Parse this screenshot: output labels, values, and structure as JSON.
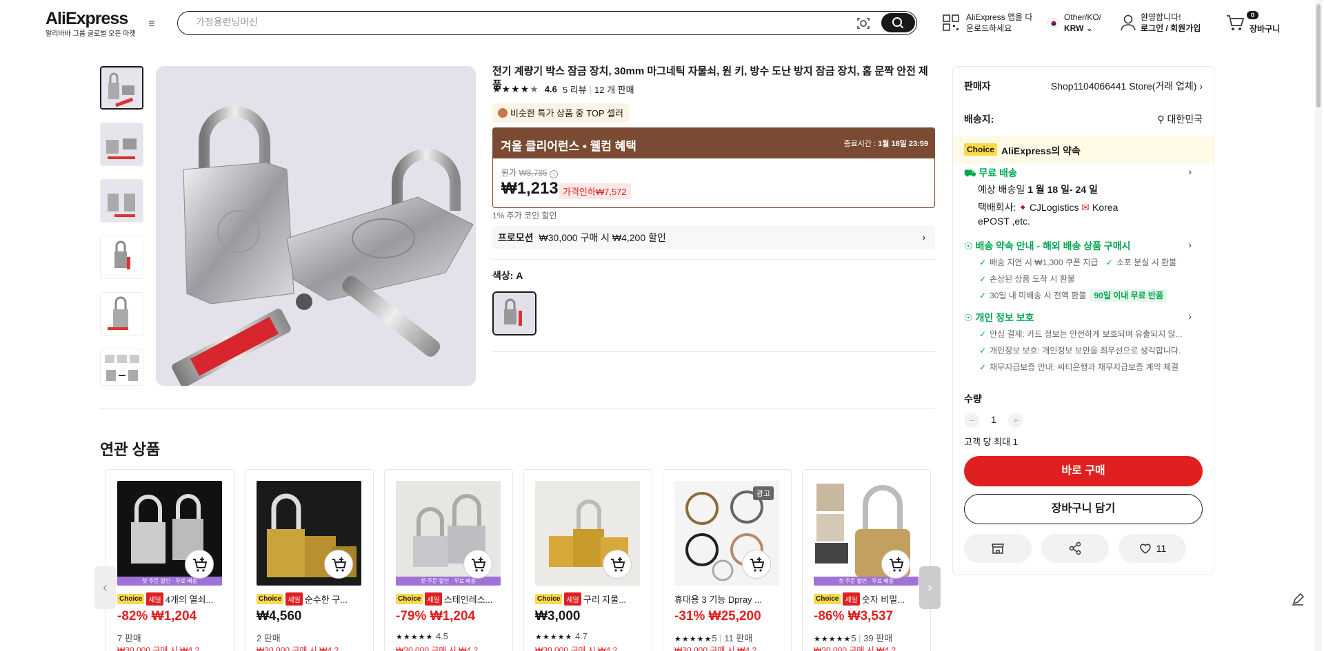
{
  "header": {
    "logo": "AliExpress",
    "logo_sub": "알리바바 그룹 글로벌 오픈 마켓",
    "search_placeholder": "가정용런닝머신",
    "app_line1": "AliExpress 앱을 다",
    "app_line2": "운로드하세요",
    "lang_line1": "Other/KO/",
    "lang_line2": "KRW",
    "welcome_line1": "환영합니다!",
    "welcome_line2": "로그인 / 회원가입",
    "cart_count": "0",
    "cart_label": "장바구니"
  },
  "product": {
    "title": "전기 계량기 박스 잠금 장치, 30mm 마그네틱 자물쇠, 원 키, 방수 도난 방지 잠금 장치, 홈 문짝 안전 제품",
    "rating": "4.6",
    "reviews": "5 리뷰",
    "sold": "12 개 판매",
    "top_badge": "비슷한 특가 상품 중 TOP 셀러",
    "promo_title": "겨울 클리어런스 • 웰컴 혜택",
    "promo_end_label": "종료시간 :",
    "promo_end_date": "1월 18일 23:59",
    "orig_label": "원가",
    "orig_price": "₩8,785",
    "price": "₩1,213",
    "discount": "가격인하₩7,572",
    "coin_note": "1% 추가 코인 할인",
    "promotion_label": "프로모션",
    "promotion_text": "₩30,000 구매 시 ₩4,200 할인",
    "color_label": "색상: A"
  },
  "related": {
    "title": "연관 상품",
    "strip_text": "첫 주문 할인 · 무료 배송",
    "ad_label": "광고",
    "items": [
      {
        "choice": "Choice",
        "sale": "세일",
        "name": "4개의 열쇠...",
        "discount": "-82%",
        "price": "₩1,204",
        "sold": "7 판매",
        "rating": "",
        "promo": "₩30,000 구매 시 ₩4,2"
      },
      {
        "choice": "Choice",
        "sale": "세일",
        "name": "순수한 구...",
        "discount": "",
        "price": "₩4,560",
        "sold": "2 판매",
        "rating": "",
        "promo": "₩30,000 구매 시 ₩4,2"
      },
      {
        "choice": "Choice",
        "sale": "세일",
        "name": "스테인레스...",
        "discount": "-79%",
        "price": "₩1,204",
        "sold": "",
        "rating": "4.5",
        "promo": "₩30,000 구매 시 ₩4,2"
      },
      {
        "choice": "Choice",
        "sale": "세일",
        "name": "구리 자물...",
        "discount": "",
        "price": "₩3,000",
        "sold": "",
        "rating": "4.7",
        "promo": "₩30,000 구매 시 ₩4,2"
      },
      {
        "choice": "",
        "sale": "",
        "name": "휴대용 3 기능 Dpray ...",
        "discount": "-31%",
        "price": "₩25,200",
        "sold": "11 판매",
        "rating": "5",
        "promo": "₩30,000 구매 시 ₩4,2"
      },
      {
        "choice": "Choice",
        "sale": "세일",
        "name": "숫자 비밀...",
        "discount": "-86%",
        "price": "₩3,537",
        "sold": "39 판매",
        "rating": "5",
        "promo": "₩30,000 구매 시 ₩4,2"
      }
    ]
  },
  "panel": {
    "seller_label": "판매자",
    "seller_value": "Shop1104066441 Store(거래 업체)",
    "ship_label": "배송지:",
    "ship_value": "대한민국",
    "choice_tag": "Choice",
    "choice_text": "AliExpress의 약속",
    "free_ship": "무료 배송",
    "eta_label": "예상 배송일",
    "eta_value": "1 월 18 일- 24 일",
    "carrier_label": "택배회사:",
    "carrier_1": "CJLogistics",
    "carrier_2": "Korea",
    "carrier_3": "ePOST ,etc.",
    "promise_title": "배송 약속 안내 - 해외 배송 상품 구매시",
    "promise_b1": "배송 지연 시 ₩1,300 쿠폰 지급",
    "promise_b2": "소포 분실 시 환불",
    "promise_b3": "손상된 상품 도착 시 환불",
    "promise_b4": "30일 내 미배송 시 전액 환불",
    "promise_tag": "90일 이내 무료 반품",
    "privacy_title": "개인 정보 보호",
    "privacy_b1": "안심 결제: 카드 정보는 안전하게 보호되며 유출되지 않...",
    "privacy_b2": "개인정보 보호: 개인정보 보안을 최우선으로 생각합니다.",
    "privacy_b3": "채무지급보증 안내: 씨티은행과 채무지급보증 계약 체결",
    "qty_label": "수량",
    "qty_value": "1",
    "qty_limit": "고객 당 최대 1",
    "buy_now": "바로 구매",
    "add_cart": "장바구니 담기",
    "wish_count": "11"
  },
  "icons": [
    "menu-icon",
    "camera-icon",
    "search-icon",
    "qr-icon",
    "flag-kr-icon",
    "user-icon",
    "cart-icon",
    "location-icon",
    "truck-icon",
    "shield-icon",
    "store-icon",
    "share-icon",
    "heart-icon",
    "edit-icon"
  ],
  "colors": {
    "accent": "#e02020",
    "promo_bg": "#7a4b32",
    "choice_yellow": "#fed94a",
    "green": "#00a650"
  }
}
